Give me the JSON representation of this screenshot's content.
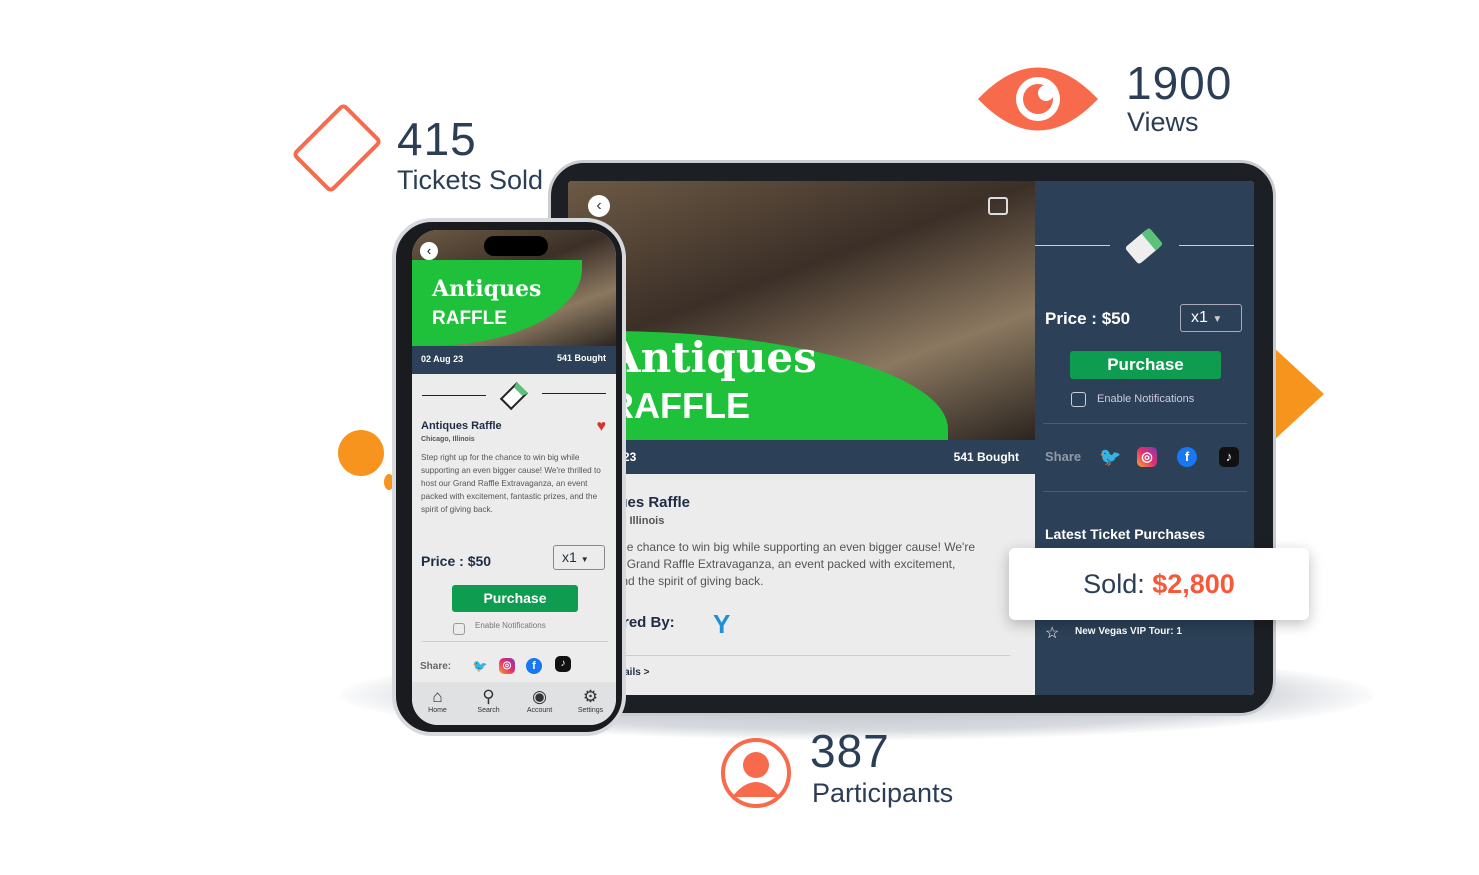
{
  "stats": {
    "tickets": {
      "value": "415",
      "label": "Tickets Sold",
      "icon": "ticket-icon"
    },
    "views": {
      "value": "1900",
      "label": "Views",
      "icon": "eye-icon"
    },
    "participants": {
      "value": "387",
      "label": "Participants",
      "icon": "user-icon"
    },
    "sold": {
      "label": "Sold:",
      "value": "$2,800"
    }
  },
  "colors": {
    "accent": "#f76a4c",
    "navy": "#2c4057",
    "green": "#0e9d50",
    "orange": "#f7941d"
  },
  "event": {
    "title_script": "Antiques",
    "title_caps": "RAFFLE",
    "date": "02 Aug 23",
    "bought": "541 Bought",
    "name": "Antiques Raffle",
    "location": "Chicago, Illinois",
    "description": "Step right up for the chance to win big while supporting an even bigger cause! We're thrilled to host our Grand Raffle Extravaganza, an event packed with excitement, fantastic prizes, and the spirit of giving back.",
    "sponsored_by": "Sponsored By:",
    "details": "Details >",
    "price": "Price : $50",
    "quantity": "x1",
    "purchase": "Purchase",
    "notifications": "Enable Notifications",
    "share": "Share",
    "share_phone": "Share:",
    "latest": "Latest Ticket Purchases",
    "latest_item": "New Vegas VIP Tour: 1"
  },
  "nav": [
    {
      "label": "Home",
      "icon": "home-icon"
    },
    {
      "label": "Search",
      "icon": "search-icon"
    },
    {
      "label": "Account",
      "icon": "account-icon"
    },
    {
      "label": "Settings",
      "icon": "settings-icon"
    }
  ]
}
